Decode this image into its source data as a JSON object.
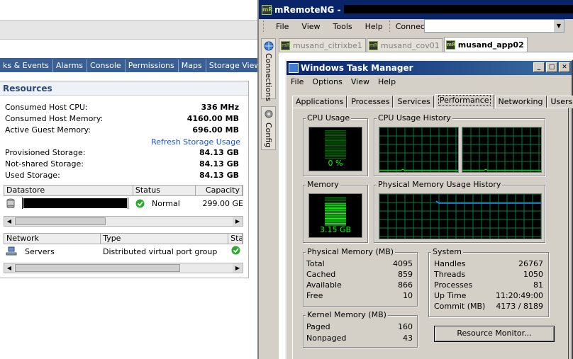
{
  "vsphere": {
    "tabs": [
      "ks & Events",
      "Alarms",
      "Console",
      "Permissions",
      "Maps",
      "Storage Views"
    ],
    "resources": {
      "title": "Resources",
      "consumed_cpu_label": "Consumed Host CPU:",
      "consumed_cpu_value": "336 MHz",
      "consumed_mem_label": "Consumed Host Memory:",
      "consumed_mem_value": "4160.00 MB",
      "active_guest_label": "Active Guest Memory:",
      "active_guest_value": "696.00 MB",
      "refresh_link": "Refresh Storage Usage",
      "provisioned_label": "Provisioned Storage:",
      "provisioned_value": "84.13 GB",
      "notshared_label": "Not-shared Storage:",
      "notshared_value": "84.13 GB",
      "used_label": "Used Storage:",
      "used_value": "84.13 GB"
    },
    "datastore_table": {
      "headers": [
        "Datastore",
        "Status",
        "Capacity"
      ],
      "rows": [
        {
          "status": "Normal",
          "capacity": "299.00 GE"
        }
      ]
    },
    "network_table": {
      "headers": [
        "Network",
        "Type",
        "Sta"
      ],
      "rows": [
        {
          "name": "Servers",
          "type": "Distributed virtual port group"
        }
      ]
    }
  },
  "mremote": {
    "title": "mRemoteNG - C",
    "menu": [
      "File",
      "View",
      "Tools",
      "Help"
    ],
    "connect_label": "Connect:",
    "connect_value": "",
    "sidebar_tabs": [
      "Connections",
      "Config"
    ],
    "doc_tabs": [
      "musand_citrixbe1",
      "musand_cov01",
      "musand_app02"
    ],
    "active_doc_tab": "musand_app02"
  },
  "taskmanager": {
    "title": "Windows Task Manager",
    "menu": [
      "File",
      "Options",
      "View",
      "Help"
    ],
    "tabs": [
      "Applications",
      "Processes",
      "Services",
      "Performance",
      "Networking",
      "Users"
    ],
    "active_tab": "Performance",
    "cpu_usage_label": "CPU Usage",
    "cpu_usage_value": "0 %",
    "cpu_history_label": "CPU Usage History",
    "memory_label": "Memory",
    "memory_value": "3.15 GB",
    "mem_history_label": "Physical Memory Usage History",
    "physical_memory": {
      "label": "Physical Memory (MB)",
      "total_label": "Total",
      "total": "4095",
      "cached_label": "Cached",
      "cached": "859",
      "available_label": "Available",
      "available": "866",
      "free_label": "Free",
      "free": "10"
    },
    "kernel_memory": {
      "label": "Kernel Memory (MB)",
      "paged_label": "Paged",
      "paged": "160",
      "nonpaged_label": "Nonpaged",
      "nonpaged": "43"
    },
    "system": {
      "label": "System",
      "handles_label": "Handles",
      "handles": "26767",
      "threads_label": "Threads",
      "threads": "1050",
      "processes_label": "Processes",
      "processes": "81",
      "uptime_label": "Up Time",
      "uptime": "11:20:49:00",
      "commit_label": "Commit (MB)",
      "commit": "4173 / 8189"
    },
    "resource_monitor_button": "Resource Monitor...",
    "memory_fill_fraction": 0.77,
    "cpu_fill_fraction": 0.0
  },
  "colors": {
    "graph_green": "#00ff00",
    "grid_green": "#008040",
    "history_blue": "#1e90ff",
    "title_blue": "#0a246a"
  }
}
